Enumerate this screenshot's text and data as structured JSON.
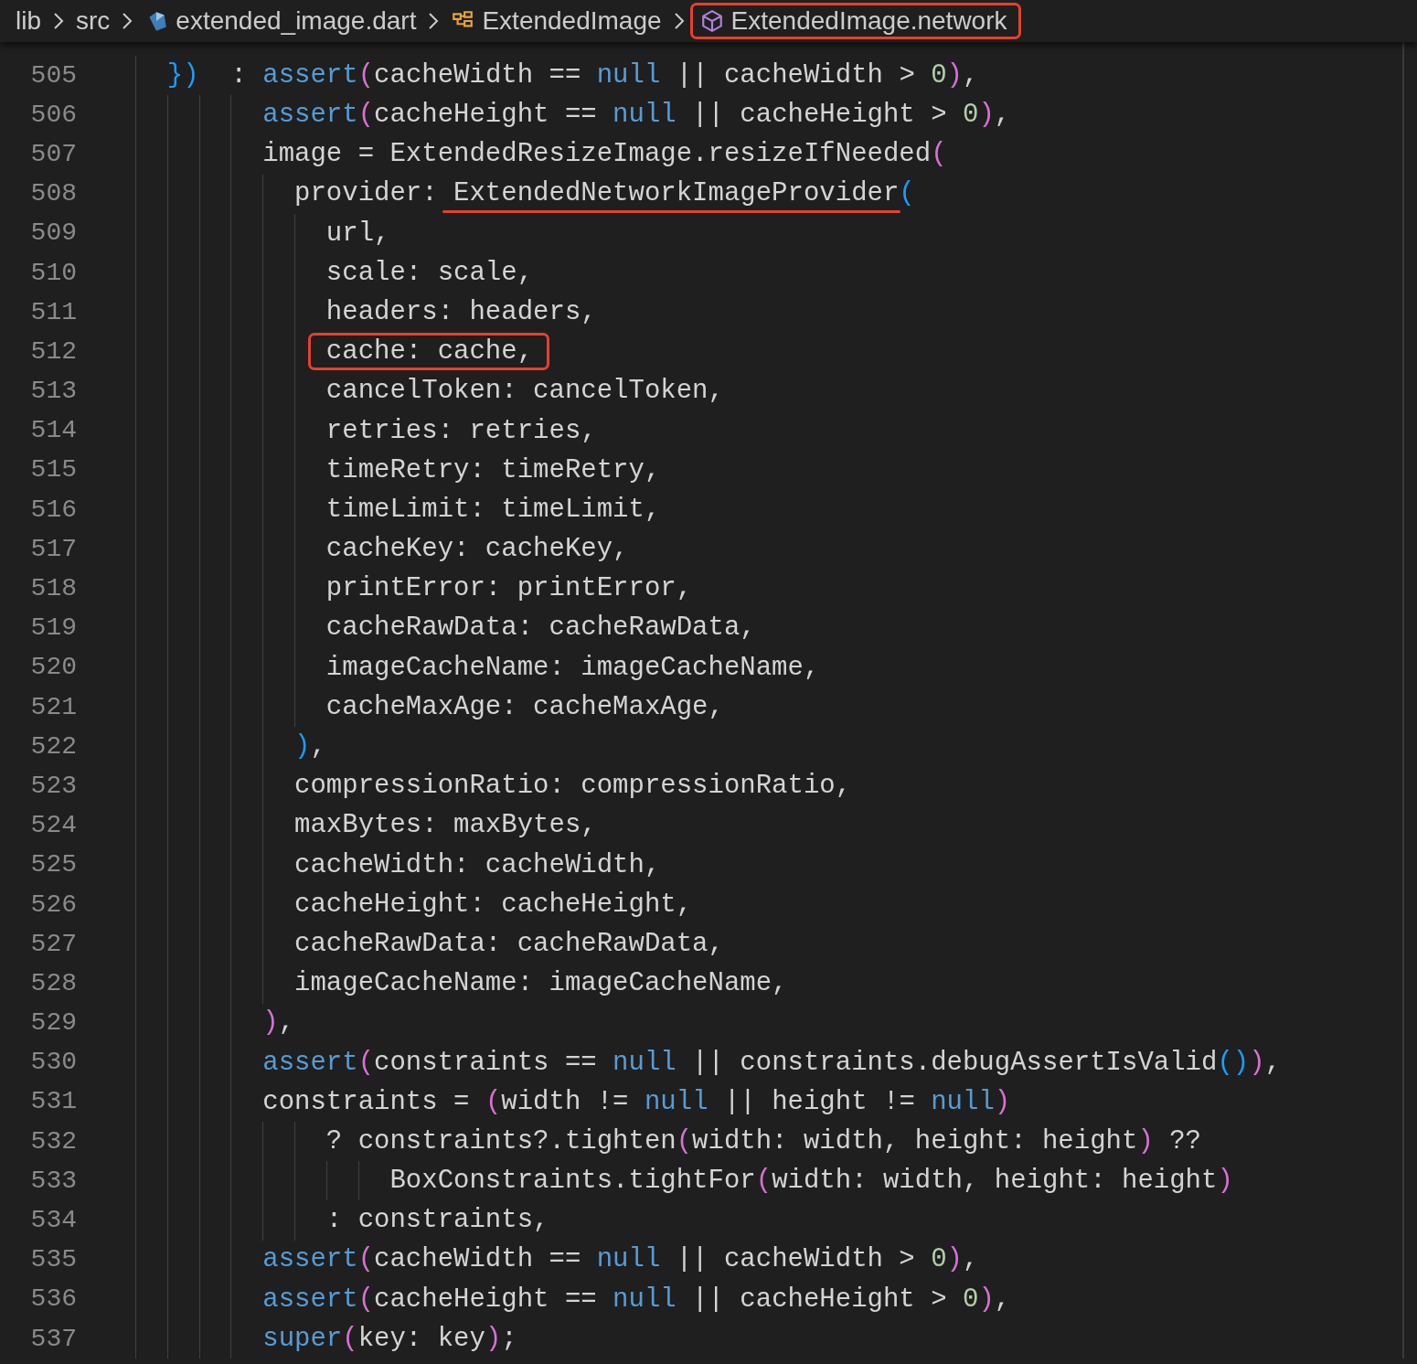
{
  "breadcrumb": [
    {
      "label": "lib",
      "kind": "folder",
      "boxed": false
    },
    {
      "label": "src",
      "kind": "folder",
      "boxed": false
    },
    {
      "label": "extended_image.dart",
      "kind": "file",
      "boxed": false
    },
    {
      "label": "ExtendedImage",
      "kind": "class",
      "boxed": false
    },
    {
      "label": "ExtendedImage.network",
      "kind": "method",
      "boxed": true
    }
  ],
  "lines": [
    {
      "number": "505",
      "tokens": [
        {
          "text": "  })",
          "kind": "bracket2"
        },
        {
          "text": "  : ",
          "kind": "plain"
        },
        {
          "text": "assert",
          "kind": "keyword"
        },
        {
          "text": "(",
          "kind": "bracket1"
        },
        {
          "text": "cacheWidth == ",
          "kind": "plain"
        },
        {
          "text": "null",
          "kind": "keyword"
        },
        {
          "text": " || cacheWidth > ",
          "kind": "plain"
        },
        {
          "text": "0",
          "kind": "number"
        },
        {
          "text": ")",
          "kind": "bracket1"
        },
        {
          "text": ",",
          "kind": "plain"
        }
      ]
    },
    {
      "number": "506",
      "tokens": [
        {
          "text": "        assert",
          "kind": "keyword"
        },
        {
          "text": "(",
          "kind": "bracket1"
        },
        {
          "text": "cacheHeight == ",
          "kind": "plain"
        },
        {
          "text": "null",
          "kind": "keyword"
        },
        {
          "text": " || cacheHeight > ",
          "kind": "plain"
        },
        {
          "text": "0",
          "kind": "number"
        },
        {
          "text": ")",
          "kind": "bracket1"
        },
        {
          "text": ",",
          "kind": "plain"
        }
      ]
    },
    {
      "number": "507",
      "tokens": [
        {
          "text": "        image = ExtendedResizeImage.resizeIfNeeded",
          "kind": "plain"
        },
        {
          "text": "(",
          "kind": "bracket1"
        }
      ]
    },
    {
      "number": "508",
      "tokens": [
        {
          "text": "          provider: ",
          "kind": "plain"
        },
        {
          "text": "ExtendedNetworkImageProvider",
          "kind": "plain",
          "underlined": true
        },
        {
          "text": "(",
          "kind": "bracket2"
        }
      ]
    },
    {
      "number": "509",
      "tokens": [
        {
          "text": "            url,",
          "kind": "plain"
        }
      ]
    },
    {
      "number": "510",
      "tokens": [
        {
          "text": "            scale: scale,",
          "kind": "plain"
        }
      ]
    },
    {
      "number": "511",
      "tokens": [
        {
          "text": "            headers: headers,",
          "kind": "plain"
        }
      ]
    },
    {
      "number": "512",
      "tokens": [
        {
          "text": "            cache: cache,",
          "kind": "plain",
          "boxed": true
        }
      ]
    },
    {
      "number": "513",
      "tokens": [
        {
          "text": "            cancelToken: cancelToken,",
          "kind": "plain"
        }
      ]
    },
    {
      "number": "514",
      "tokens": [
        {
          "text": "            retries: retries,",
          "kind": "plain"
        }
      ]
    },
    {
      "number": "515",
      "tokens": [
        {
          "text": "            timeRetry: timeRetry,",
          "kind": "plain"
        }
      ]
    },
    {
      "number": "516",
      "tokens": [
        {
          "text": "            timeLimit: timeLimit,",
          "kind": "plain"
        }
      ]
    },
    {
      "number": "517",
      "tokens": [
        {
          "text": "            cacheKey: cacheKey,",
          "kind": "plain"
        }
      ]
    },
    {
      "number": "518",
      "tokens": [
        {
          "text": "            printError: printError,",
          "kind": "plain"
        }
      ]
    },
    {
      "number": "519",
      "tokens": [
        {
          "text": "            cacheRawData: cacheRawData,",
          "kind": "plain"
        }
      ]
    },
    {
      "number": "520",
      "tokens": [
        {
          "text": "            imageCacheName: imageCacheName,",
          "kind": "plain"
        }
      ]
    },
    {
      "number": "521",
      "tokens": [
        {
          "text": "            cacheMaxAge: cacheMaxAge,",
          "kind": "plain"
        }
      ]
    },
    {
      "number": "522",
      "tokens": [
        {
          "text": "          )",
          "kind": "bracket2"
        },
        {
          "text": ",",
          "kind": "plain"
        }
      ]
    },
    {
      "number": "523",
      "tokens": [
        {
          "text": "          compressionRatio: compressionRatio,",
          "kind": "plain"
        }
      ]
    },
    {
      "number": "524",
      "tokens": [
        {
          "text": "          maxBytes: maxBytes,",
          "kind": "plain"
        }
      ]
    },
    {
      "number": "525",
      "tokens": [
        {
          "text": "          cacheWidth: cacheWidth,",
          "kind": "plain"
        }
      ]
    },
    {
      "number": "526",
      "tokens": [
        {
          "text": "          cacheHeight: cacheHeight,",
          "kind": "plain"
        }
      ]
    },
    {
      "number": "527",
      "tokens": [
        {
          "text": "          cacheRawData: cacheRawData,",
          "kind": "plain"
        }
      ]
    },
    {
      "number": "528",
      "tokens": [
        {
          "text": "          imageCacheName: imageCacheName,",
          "kind": "plain"
        }
      ]
    },
    {
      "number": "529",
      "tokens": [
        {
          "text": "        )",
          "kind": "bracket1"
        },
        {
          "text": ",",
          "kind": "plain"
        }
      ]
    },
    {
      "number": "530",
      "tokens": [
        {
          "text": "        assert",
          "kind": "keyword"
        },
        {
          "text": "(",
          "kind": "bracket1"
        },
        {
          "text": "constraints == ",
          "kind": "plain"
        },
        {
          "text": "null",
          "kind": "keyword"
        },
        {
          "text": " || constraints.debugAssertIsValid",
          "kind": "plain"
        },
        {
          "text": "()",
          "kind": "bracket2"
        },
        {
          "text": ")",
          "kind": "bracket1"
        },
        {
          "text": ",",
          "kind": "plain"
        }
      ]
    },
    {
      "number": "531",
      "tokens": [
        {
          "text": "        constraints = ",
          "kind": "plain"
        },
        {
          "text": "(",
          "kind": "bracket1"
        },
        {
          "text": "width != ",
          "kind": "plain"
        },
        {
          "text": "null",
          "kind": "keyword"
        },
        {
          "text": " || height != ",
          "kind": "plain"
        },
        {
          "text": "null",
          "kind": "keyword"
        },
        {
          "text": ")",
          "kind": "bracket1"
        }
      ]
    },
    {
      "number": "532",
      "tokens": [
        {
          "text": "            ? constraints?.tighten",
          "kind": "plain"
        },
        {
          "text": "(",
          "kind": "bracket1"
        },
        {
          "text": "width: width, height: height",
          "kind": "plain"
        },
        {
          "text": ")",
          "kind": "bracket1"
        },
        {
          "text": " ??",
          "kind": "plain"
        }
      ]
    },
    {
      "number": "533",
      "tokens": [
        {
          "text": "                BoxConstraints.tightFor",
          "kind": "plain"
        },
        {
          "text": "(",
          "kind": "bracket1"
        },
        {
          "text": "width: width, height: height",
          "kind": "plain"
        },
        {
          "text": ")",
          "kind": "bracket1"
        }
      ]
    },
    {
      "number": "534",
      "tokens": [
        {
          "text": "            : constraints,",
          "kind": "plain"
        }
      ]
    },
    {
      "number": "535",
      "tokens": [
        {
          "text": "        assert",
          "kind": "keyword"
        },
        {
          "text": "(",
          "kind": "bracket1"
        },
        {
          "text": "cacheWidth == ",
          "kind": "plain"
        },
        {
          "text": "null",
          "kind": "keyword"
        },
        {
          "text": " || cacheWidth > ",
          "kind": "plain"
        },
        {
          "text": "0",
          "kind": "number"
        },
        {
          "text": ")",
          "kind": "bracket1"
        },
        {
          "text": ",",
          "kind": "plain"
        }
      ]
    },
    {
      "number": "536",
      "tokens": [
        {
          "text": "        assert",
          "kind": "keyword"
        },
        {
          "text": "(",
          "kind": "bracket1"
        },
        {
          "text": "cacheHeight == ",
          "kind": "plain"
        },
        {
          "text": "null",
          "kind": "keyword"
        },
        {
          "text": " || cacheHeight > ",
          "kind": "plain"
        },
        {
          "text": "0",
          "kind": "number"
        },
        {
          "text": ")",
          "kind": "bracket1"
        },
        {
          "text": ",",
          "kind": "plain"
        }
      ]
    },
    {
      "number": "537",
      "tokens": [
        {
          "text": "        super",
          "kind": "keyword"
        },
        {
          "text": "(",
          "kind": "bracket1"
        },
        {
          "text": "key: key",
          "kind": "plain"
        },
        {
          "text": ")",
          "kind": "bracket1"
        },
        {
          "text": ";",
          "kind": "plain"
        }
      ]
    }
  ]
}
